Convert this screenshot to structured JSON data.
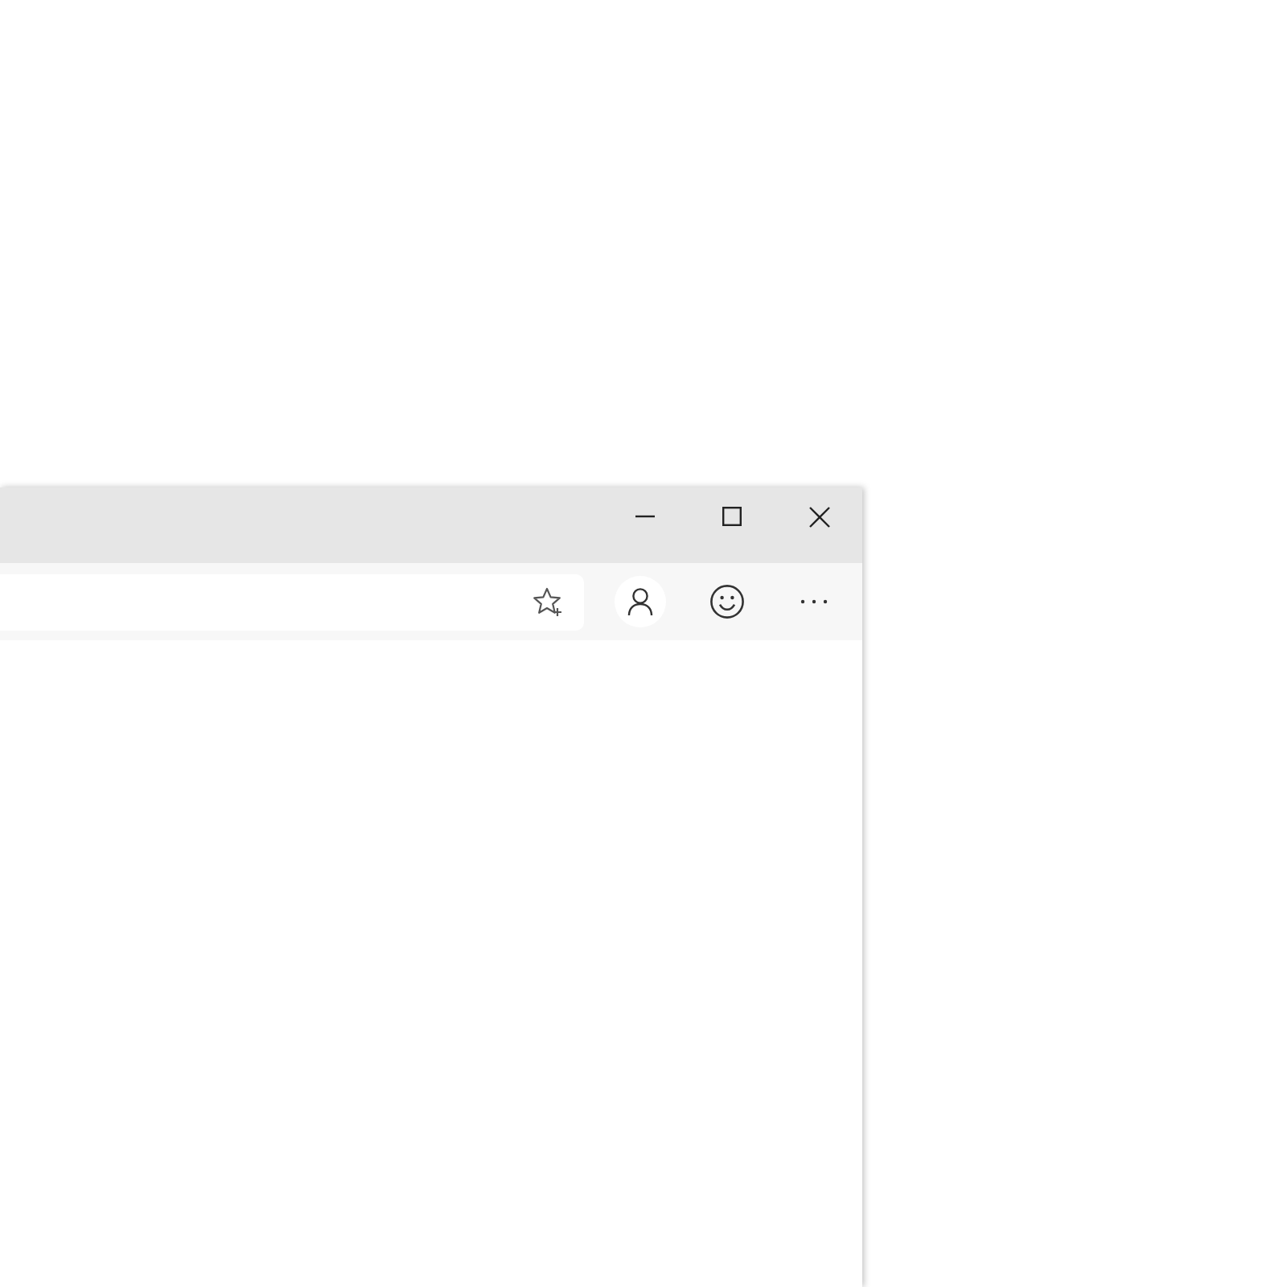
{
  "title_bar": {
    "controls": [
      {
        "kind": "minimize"
      },
      {
        "kind": "maximize"
      },
      {
        "kind": "close"
      }
    ]
  },
  "address_bar": {
    "actions": [
      {
        "kind": "favorite"
      }
    ]
  },
  "toolbar": {
    "buttons": [
      {
        "kind": "profile"
      },
      {
        "kind": "feedback"
      },
      {
        "kind": "menu"
      }
    ]
  }
}
